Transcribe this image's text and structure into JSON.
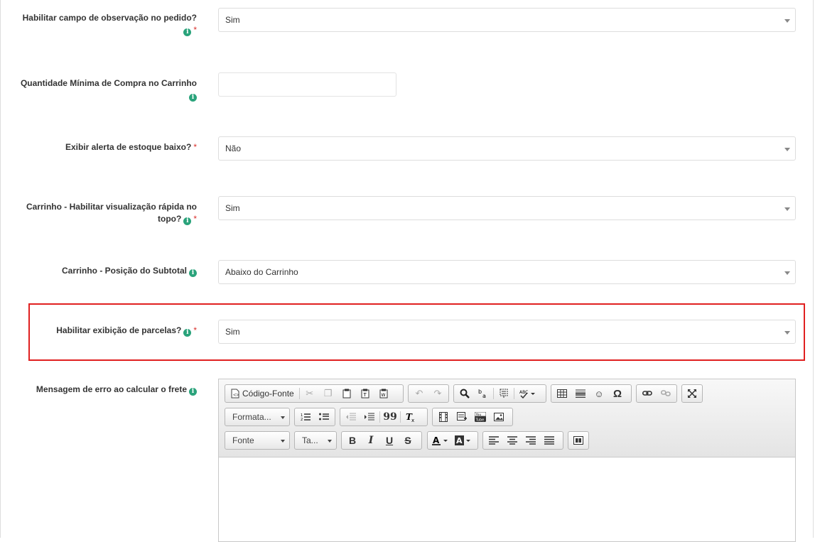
{
  "fields": [
    {
      "label": "Habilitar campo de observação no pedido?",
      "value": "Sim"
    },
    {
      "label": "Quantidade Mínima de Compra no Carrinho",
      "value": ""
    },
    {
      "label": "Exibir alerta de estoque baixo?",
      "value": "Não"
    },
    {
      "label_line1": "Carrinho - Habilitar visualização rápida no",
      "label_line2": "topo?",
      "value": "Sim"
    },
    {
      "label": "Carrinho - Posição do Subtotal",
      "value": "Abaixo do Carrinho"
    },
    {
      "label": "Habilitar exibição de parcelas?",
      "value": "Sim"
    },
    {
      "label": "Mensagem de erro ao calcular o frete"
    }
  ],
  "required_mark": "*",
  "info_glyph": "i",
  "editor": {
    "source_label": "Código-Fonte",
    "format_label": "Formata...",
    "font_label": "Fonte",
    "size_label": "Ta...",
    "bold": "B",
    "italic": "I",
    "underline": "U",
    "strike": "S",
    "omega": "Ω",
    "quote": "99"
  },
  "colors": {
    "info": "#2aa37b",
    "required": "#d9302c",
    "highlight": "#e02020"
  }
}
